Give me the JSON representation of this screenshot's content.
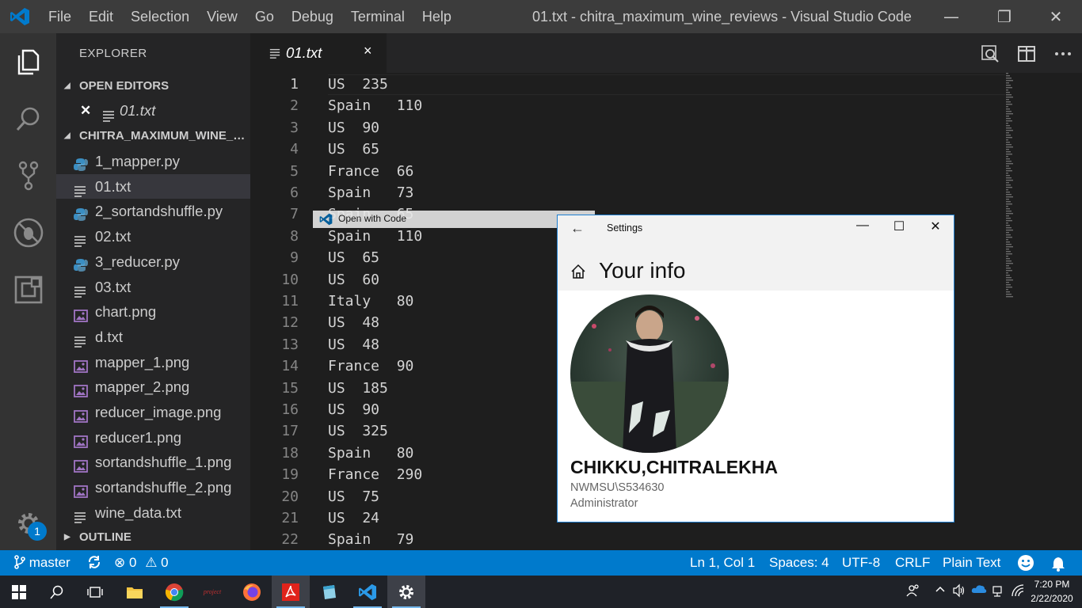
{
  "titlebar": {
    "menu": [
      "File",
      "Edit",
      "Selection",
      "View",
      "Go",
      "Debug",
      "Terminal",
      "Help"
    ],
    "window_title": "01.txt - chitra_maximum_wine_reviews - Visual Studio Code",
    "controls": {
      "minimize": "—",
      "restore": "❐",
      "close": "✕"
    }
  },
  "activity_bar": {
    "items": [
      "files-icon",
      "search-icon",
      "source-control-icon",
      "debug-icon",
      "extensions-icon"
    ],
    "settings_badge": "1"
  },
  "sidebar": {
    "title": "EXPLORER",
    "open_editors_header": "OPEN EDITORS",
    "open_editor_close": "✕",
    "open_editor_file": "01.txt",
    "folder_header": "CHITRA_MAXIMUM_WINE_REVIEWS",
    "files": [
      {
        "name": "1_mapper.py",
        "type": "python"
      },
      {
        "name": "01.txt",
        "type": "text"
      },
      {
        "name": "2_sortandshuffle.py",
        "type": "python"
      },
      {
        "name": "02.txt",
        "type": "text"
      },
      {
        "name": "3_reducer.py",
        "type": "python"
      },
      {
        "name": "03.txt",
        "type": "text"
      },
      {
        "name": "chart.png",
        "type": "image"
      },
      {
        "name": "d.txt",
        "type": "text"
      },
      {
        "name": "mapper_1.png",
        "type": "image"
      },
      {
        "name": "mapper_2.png",
        "type": "image"
      },
      {
        "name": "reducer_image.png",
        "type": "image"
      },
      {
        "name": "reducer1.png",
        "type": "image"
      },
      {
        "name": "sortandshuffle_1.png",
        "type": "image"
      },
      {
        "name": "sortandshuffle_2.png",
        "type": "image"
      },
      {
        "name": "wine_data.txt",
        "type": "text"
      }
    ],
    "selected_file": "01.txt",
    "outline_header": "OUTLINE"
  },
  "editor": {
    "tab_label": "01.txt",
    "tab_close": "×",
    "lines": [
      "US  235",
      "Spain   110",
      "US  90",
      "US  65",
      "France  66",
      "Spain   73",
      "Spain   65",
      "Spain   110",
      "US  65",
      "US  60",
      "Italy   80",
      "US  48",
      "US  48",
      "France  90",
      "US  185",
      "US  90",
      "US  325",
      "Spain   80",
      "France  290",
      "US  75",
      "US  24",
      "Spain   79"
    ]
  },
  "drag_ghost": {
    "label": "Open with Code"
  },
  "settings_window": {
    "title": "Settings",
    "heading": "Your info",
    "user_name": "CHIKKU,CHITRALEKHA",
    "account": "NWMSU\\S534630",
    "role": "Administrator"
  },
  "statusbar": {
    "branch": "master",
    "errors": "0",
    "warnings": "0",
    "position": "Ln 1, Col 1",
    "spaces": "Spaces: 4",
    "encoding": "UTF-8",
    "eol": "CRLF",
    "language": "Plain Text"
  },
  "taskbar": {
    "time": "7:20 PM",
    "date": "2/22/2020",
    "apps": [
      "windows-start-icon",
      "search-icon",
      "task-view-icon",
      "file-explorer-icon",
      "chrome-icon",
      "project-icon",
      "firefox-icon",
      "acrobat-icon",
      "notepad-icon",
      "vscode-icon",
      "settings-icon"
    ]
  },
  "colors": {
    "accent": "#007acc",
    "titlebar": "#3c3c3c",
    "activity_bar": "#333333",
    "sidebar": "#252526",
    "editor": "#1e1e1e"
  }
}
